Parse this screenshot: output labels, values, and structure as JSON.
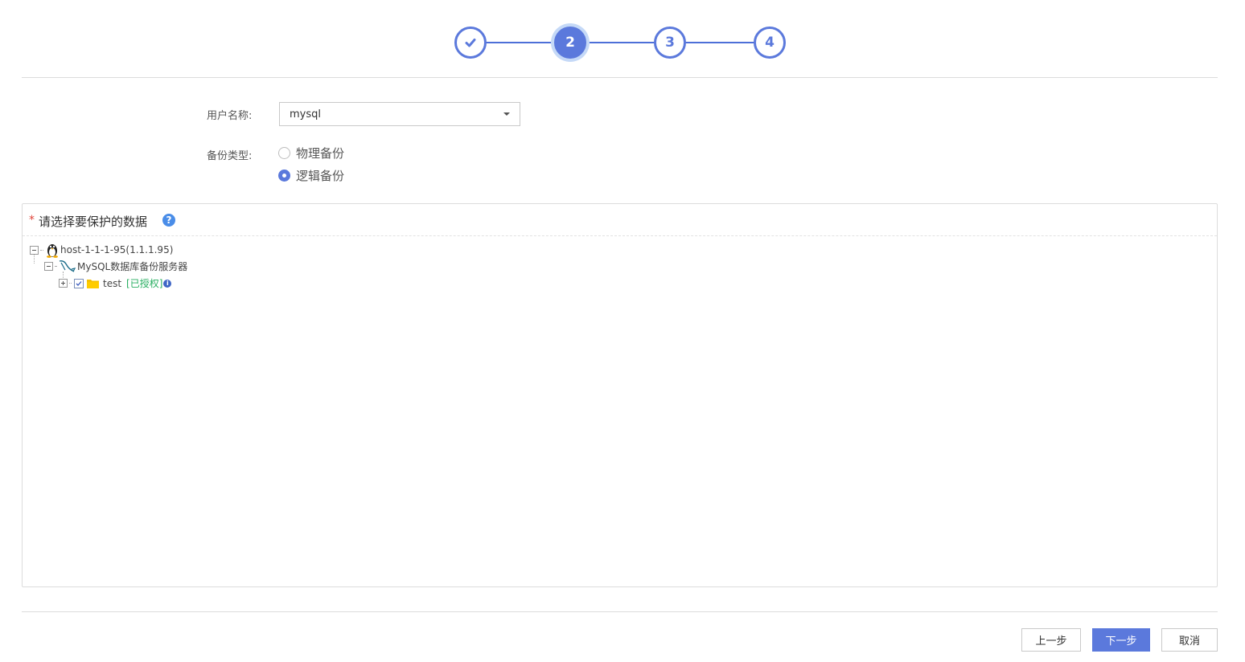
{
  "wizard": {
    "steps": [
      {
        "label": "",
        "state": "done",
        "icon": "check-icon"
      },
      {
        "label": "2",
        "state": "active"
      },
      {
        "label": "3",
        "state": "pending"
      },
      {
        "label": "4",
        "state": "pending"
      }
    ],
    "accent_color": "#5b79dc"
  },
  "form": {
    "username_label": "用户名称:",
    "username_value": "mysql",
    "backup_type_label": "备份类型:",
    "backup_options": [
      {
        "label": "物理备份",
        "selected": false
      },
      {
        "label": "逻辑备份",
        "selected": true
      }
    ]
  },
  "data_panel": {
    "required_mark": "*",
    "title": "请选择要保护的数据",
    "help_icon": "?",
    "tree": {
      "host": {
        "label": "host-1-1-1-95(1.1.1.95)",
        "icon": "linux-penguin-icon",
        "expanded": true
      },
      "service": {
        "label": "MySQL数据库备份服务器",
        "icon": "mysql-dolphin-icon",
        "expanded": true
      },
      "database": {
        "label": "test",
        "icon": "folder-icon",
        "checked": true,
        "status": "[已授权]",
        "info_icon": "i",
        "expanded": false
      }
    }
  },
  "footer": {
    "prev_label": "上一步",
    "next_label": "下一步",
    "cancel_label": "取消"
  }
}
